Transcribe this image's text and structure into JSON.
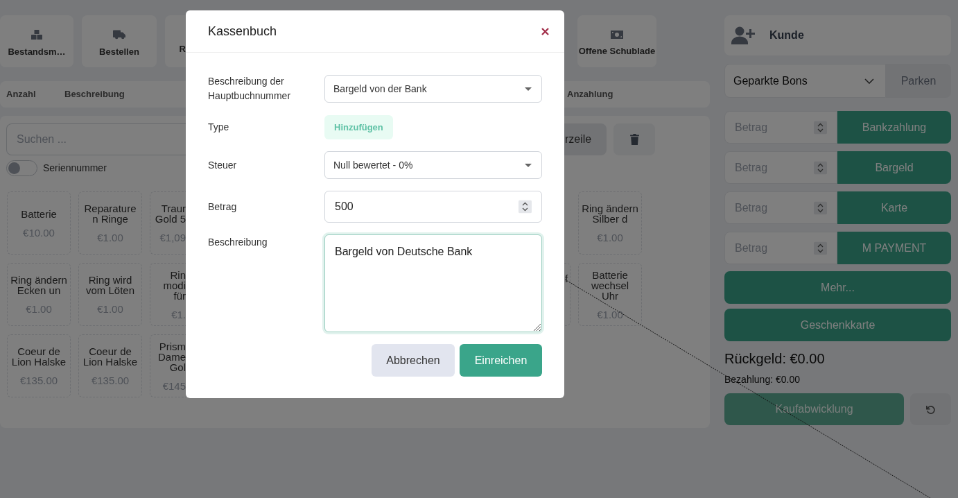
{
  "toolbar": [
    {
      "kind": "boxes",
      "label": "Bestandsm…"
    },
    {
      "kind": "truck",
      "label": "Bestellen"
    },
    {
      "kind": "cut",
      "label": "R"
    },
    {
      "kind": "money",
      "label": "Offene Schublade"
    }
  ],
  "cart_table": {
    "columns": [
      "Anzahl",
      "Beschreibung",
      "Anzahlung"
    ]
  },
  "search": {
    "placeholder": "Suchen ..."
  },
  "serial_toggle": {
    "label": "Seriennummer",
    "on": false
  },
  "line_button": {
    "label": "rzeile"
  },
  "products": {
    "rows": [
      [
        {
          "kind": "whole",
          "name": "Batterie",
          "price": "€10.00"
        },
        {
          "kind": "whole",
          "name": "Reparaturen Ringe",
          "price": "€1.00"
        },
        {
          "kind": "cut_right",
          "name": "Traur Gold 5",
          "price": "€1,09"
        },
        "",
        {
          "kind": "whole",
          "name": "Ring ändern Silber d",
          "price": "€1.00"
        }
      ],
      [
        {
          "kind": "whole",
          "name": "Ring ändern Ecken un",
          "price": "€1.00"
        },
        {
          "kind": "whole",
          "name": "Ring wird vom Löten",
          "price": "€1.00"
        },
        {
          "kind": "cut_right",
          "name": "Rin modi für",
          "price": "€1."
        },
        {
          "kind": "cut_left",
          "name": "f"
        },
        {
          "kind": "whole",
          "name": "Batterie wechsel Uhr",
          "price": "€1.00"
        }
      ],
      [
        {
          "kind": "whole",
          "name": "Coeur de Lion Halske",
          "price": "€135.00"
        },
        {
          "kind": "whole",
          "name": "Coeur de Lion Halske",
          "price": "€135.00"
        },
        {
          "kind": "cut_right",
          "name": "Prism Dame Gol",
          "price": "€145"
        },
        "",
        ""
      ]
    ]
  },
  "customer": {
    "label": "Kunde"
  },
  "parked": {
    "value": "Geparkte Bons",
    "button": "Parken"
  },
  "payments": [
    {
      "placeholder": "Betrag",
      "method": "Bankzahlung"
    },
    {
      "placeholder": "Betrag",
      "method": "Bargeld"
    },
    {
      "placeholder": "Betrag",
      "method": "Karte"
    },
    {
      "placeholder": "Betrag",
      "method": "M PAYMENT"
    }
  ],
  "more_button": "Mehr...",
  "gift_card_button": "Geschenkkarte",
  "change": "Rückgeld: €0.00",
  "paid": "Bezahlung: €0.00",
  "checkout": {
    "label": "Kaufabwicklung",
    "disabled": true
  },
  "dialog": {
    "title": "Kassenbuch",
    "fields": [
      {
        "kind": "select",
        "label": "Beschreibung der Hauptbuchnummer",
        "value": "Bargeld von der Bank",
        "focused": false
      },
      {
        "kind": "tag",
        "label": "Type",
        "value": "Hinzufügen",
        "focused": false
      },
      {
        "kind": "select",
        "label": "Steuer",
        "value": "Null bewertet - 0%",
        "focused": false
      },
      {
        "kind": "number",
        "label": "Betrag",
        "value": "500",
        "focused": false
      },
      {
        "kind": "textarea",
        "label": "Beschreibung",
        "value": "Bargeld von Deutsche Bank",
        "focused": true
      }
    ],
    "buttons": [
      {
        "kind": "secondary",
        "label": "Abbrechen"
      },
      {
        "kind": "primary",
        "label": "Einreichen"
      }
    ]
  }
}
